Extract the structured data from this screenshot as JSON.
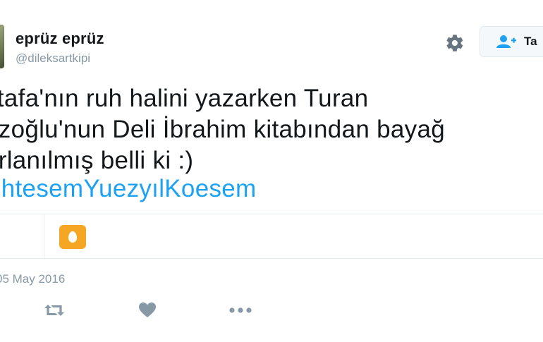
{
  "user": {
    "display_name": "eprüz eprüz",
    "username": "@dileksartkipi"
  },
  "header": {
    "settings_icon": "gear-icon",
    "follow_icon": "add-user-icon",
    "follow_label": "Ta"
  },
  "tweet": {
    "text": "stafa'nın ruh halini yazarken Turan\nazoğlu'nun Deli İbrahim kitabından bayağ\narlanılmış belli ki :)",
    "hashtag": "uhtesemYuezyılKoesem",
    "timestamp": "05 May 2016"
  },
  "card": {
    "icon": "egg-card-icon",
    "color": "#f5a623"
  },
  "actions": {
    "retweet_icon": "retweet-icon",
    "like_icon": "heart-icon",
    "more_icon": "more-icon"
  },
  "colors": {
    "link": "#1da1f2",
    "muted": "#8899a6",
    "icon": "#8899a6"
  }
}
